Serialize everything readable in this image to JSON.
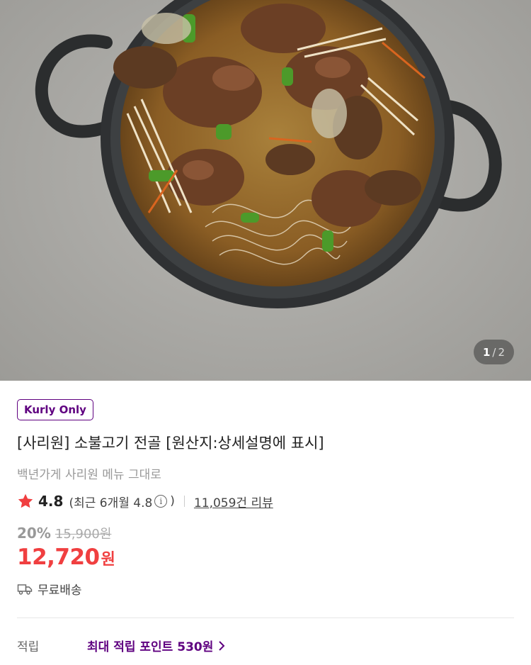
{
  "gallery": {
    "current": "1",
    "separator": "/",
    "total": "2"
  },
  "badge": "Kurly Only",
  "product": {
    "title": "[사리원] 소불고기 전골 [원산지:상세설명에 표시]",
    "subtitle": "백년가게 사리원 메뉴 그대로"
  },
  "rating": {
    "score": "4.8",
    "recent_prefix": "(최근 6개월 4.8",
    "recent_suffix": ")",
    "info_symbol": "i",
    "reviews": "11,059건 리뷰"
  },
  "price": {
    "discount": "20%",
    "original": "15,900원",
    "sale": "12,720",
    "currency": "원"
  },
  "shipping": {
    "label": "무료배송"
  },
  "points": {
    "label": "적립",
    "value": "최대 적립 포인트 530원"
  },
  "colors": {
    "brand_purple": "#5f0080",
    "price_red": "#f03f40",
    "star_red": "#f03f40"
  },
  "icons": [
    "star-icon",
    "info-icon",
    "truck-icon",
    "chevron-right-icon"
  ]
}
